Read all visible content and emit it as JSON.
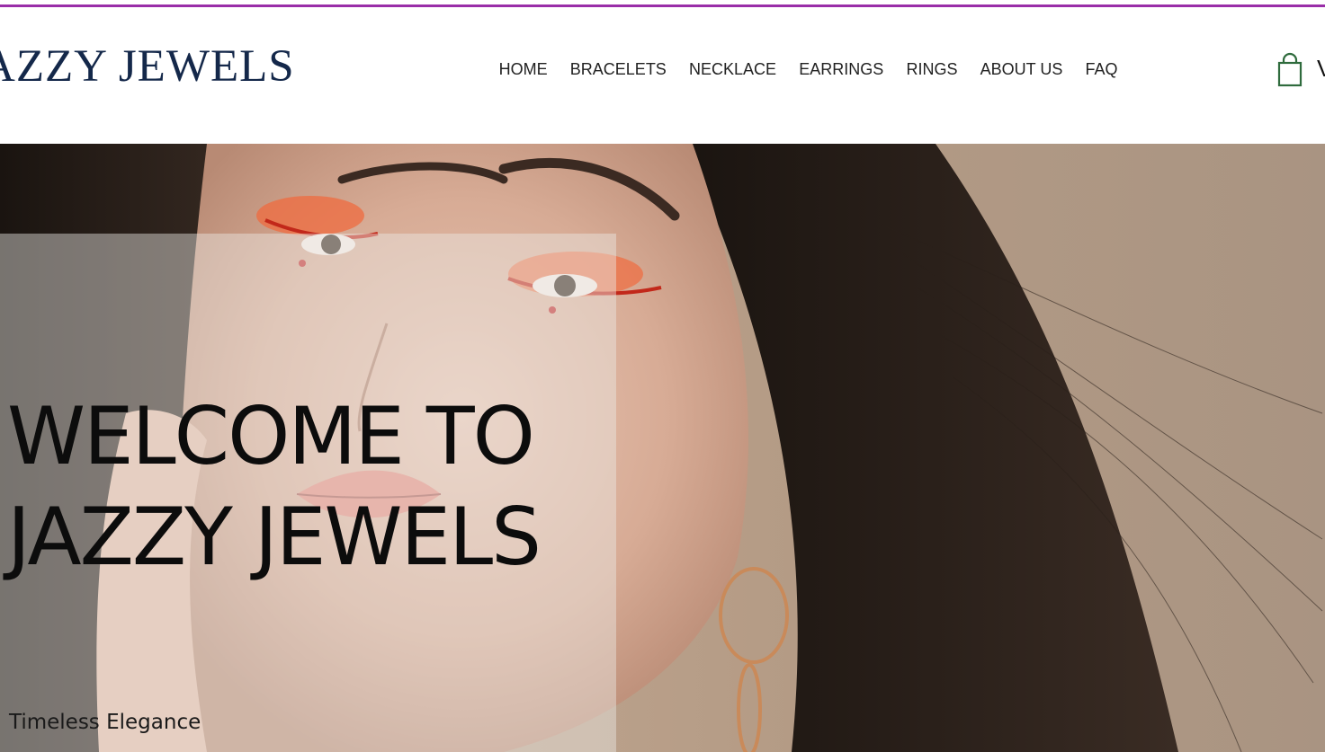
{
  "header": {
    "brand": "AZZY JEWELS",
    "nav": [
      {
        "label": "HOME"
      },
      {
        "label": "BRACELETS"
      },
      {
        "label": "NECKLACE"
      },
      {
        "label": "EARRINGS"
      },
      {
        "label": "RINGS"
      },
      {
        "label": "ABOUT US"
      },
      {
        "label": "FAQ"
      }
    ],
    "cart_icon": "shopping-bag-icon",
    "cart_partial_text": "V"
  },
  "hero": {
    "heading": "WELCOME TO JAZZY JEWELS",
    "tagline": "Timeless Elegance",
    "image": "woman-with-orange-eye-makeup-and-hoop-earrings"
  },
  "colors": {
    "accent_rule": "#9a2ea8",
    "brand_text": "#14284a",
    "cart_icon": "#2f6b3d"
  }
}
